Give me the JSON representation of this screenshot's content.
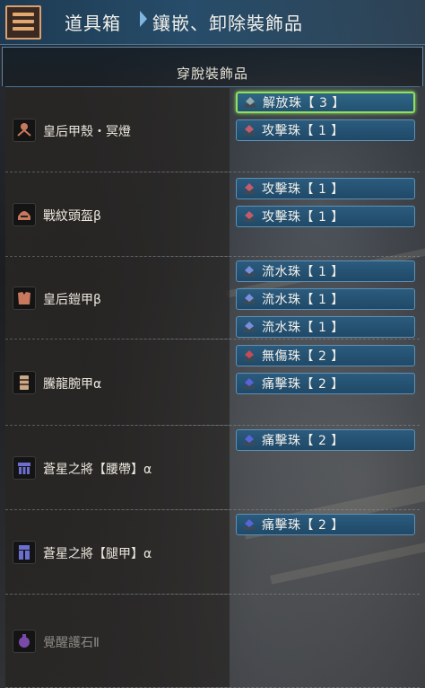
{
  "header": {
    "title": "道具箱",
    "subtitle": "鑲嵌、卸除裝飾品"
  },
  "panel": {
    "title": "穿脫裝飾品"
  },
  "equipment": [
    {
      "name": "皇后甲殼・冥燈",
      "icon": "charm-weapon-icon",
      "decorations": [
        {
          "label": "解放珠【 3 】",
          "gem_color": "#9aa8a8",
          "selected": true
        },
        {
          "label": "攻擊珠【 1 】",
          "gem_color": "#c45a6a",
          "selected": false
        }
      ]
    },
    {
      "name": "戰紋頭盔β",
      "icon": "helmet-icon",
      "decorations": [
        {
          "label": "攻擊珠【 1 】",
          "gem_color": "#c45a6a",
          "selected": false
        },
        {
          "label": "攻擊珠【 1 】",
          "gem_color": "#c45a6a",
          "selected": false
        }
      ]
    },
    {
      "name": "皇后鎧甲β",
      "icon": "chest-armor-icon",
      "decorations": [
        {
          "label": "流水珠【 1 】",
          "gem_color": "#7a8fd8",
          "selected": false
        },
        {
          "label": "流水珠【 1 】",
          "gem_color": "#7a8fd8",
          "selected": false
        },
        {
          "label": "流水珠【 1 】",
          "gem_color": "#7a8fd8",
          "selected": false
        }
      ]
    },
    {
      "name": "騰龍腕甲α",
      "icon": "gauntlet-icon",
      "decorations": [
        {
          "label": "無傷珠【 2 】",
          "gem_color": "#c84a55",
          "selected": false
        },
        {
          "label": "痛擊珠【 2 】",
          "gem_color": "#5a64d8",
          "selected": false
        }
      ]
    },
    {
      "name": "蒼星之將【腰帶】α",
      "icon": "waist-armor-icon",
      "decorations": [
        {
          "label": "痛擊珠【 2 】",
          "gem_color": "#5a64d8",
          "selected": false
        }
      ]
    },
    {
      "name": "蒼星之將【腿甲】α",
      "icon": "leg-armor-icon",
      "decorations": [
        {
          "label": "痛擊珠【 2 】",
          "gem_color": "#5a64d8",
          "selected": false
        }
      ]
    },
    {
      "name": "覺醒護石Ⅱ",
      "icon": "charm-icon",
      "dim": true,
      "decorations": []
    }
  ],
  "colors": {
    "selection": "#8fe05f",
    "deco_bg": "#245272",
    "header_bg": "#274d6a"
  }
}
